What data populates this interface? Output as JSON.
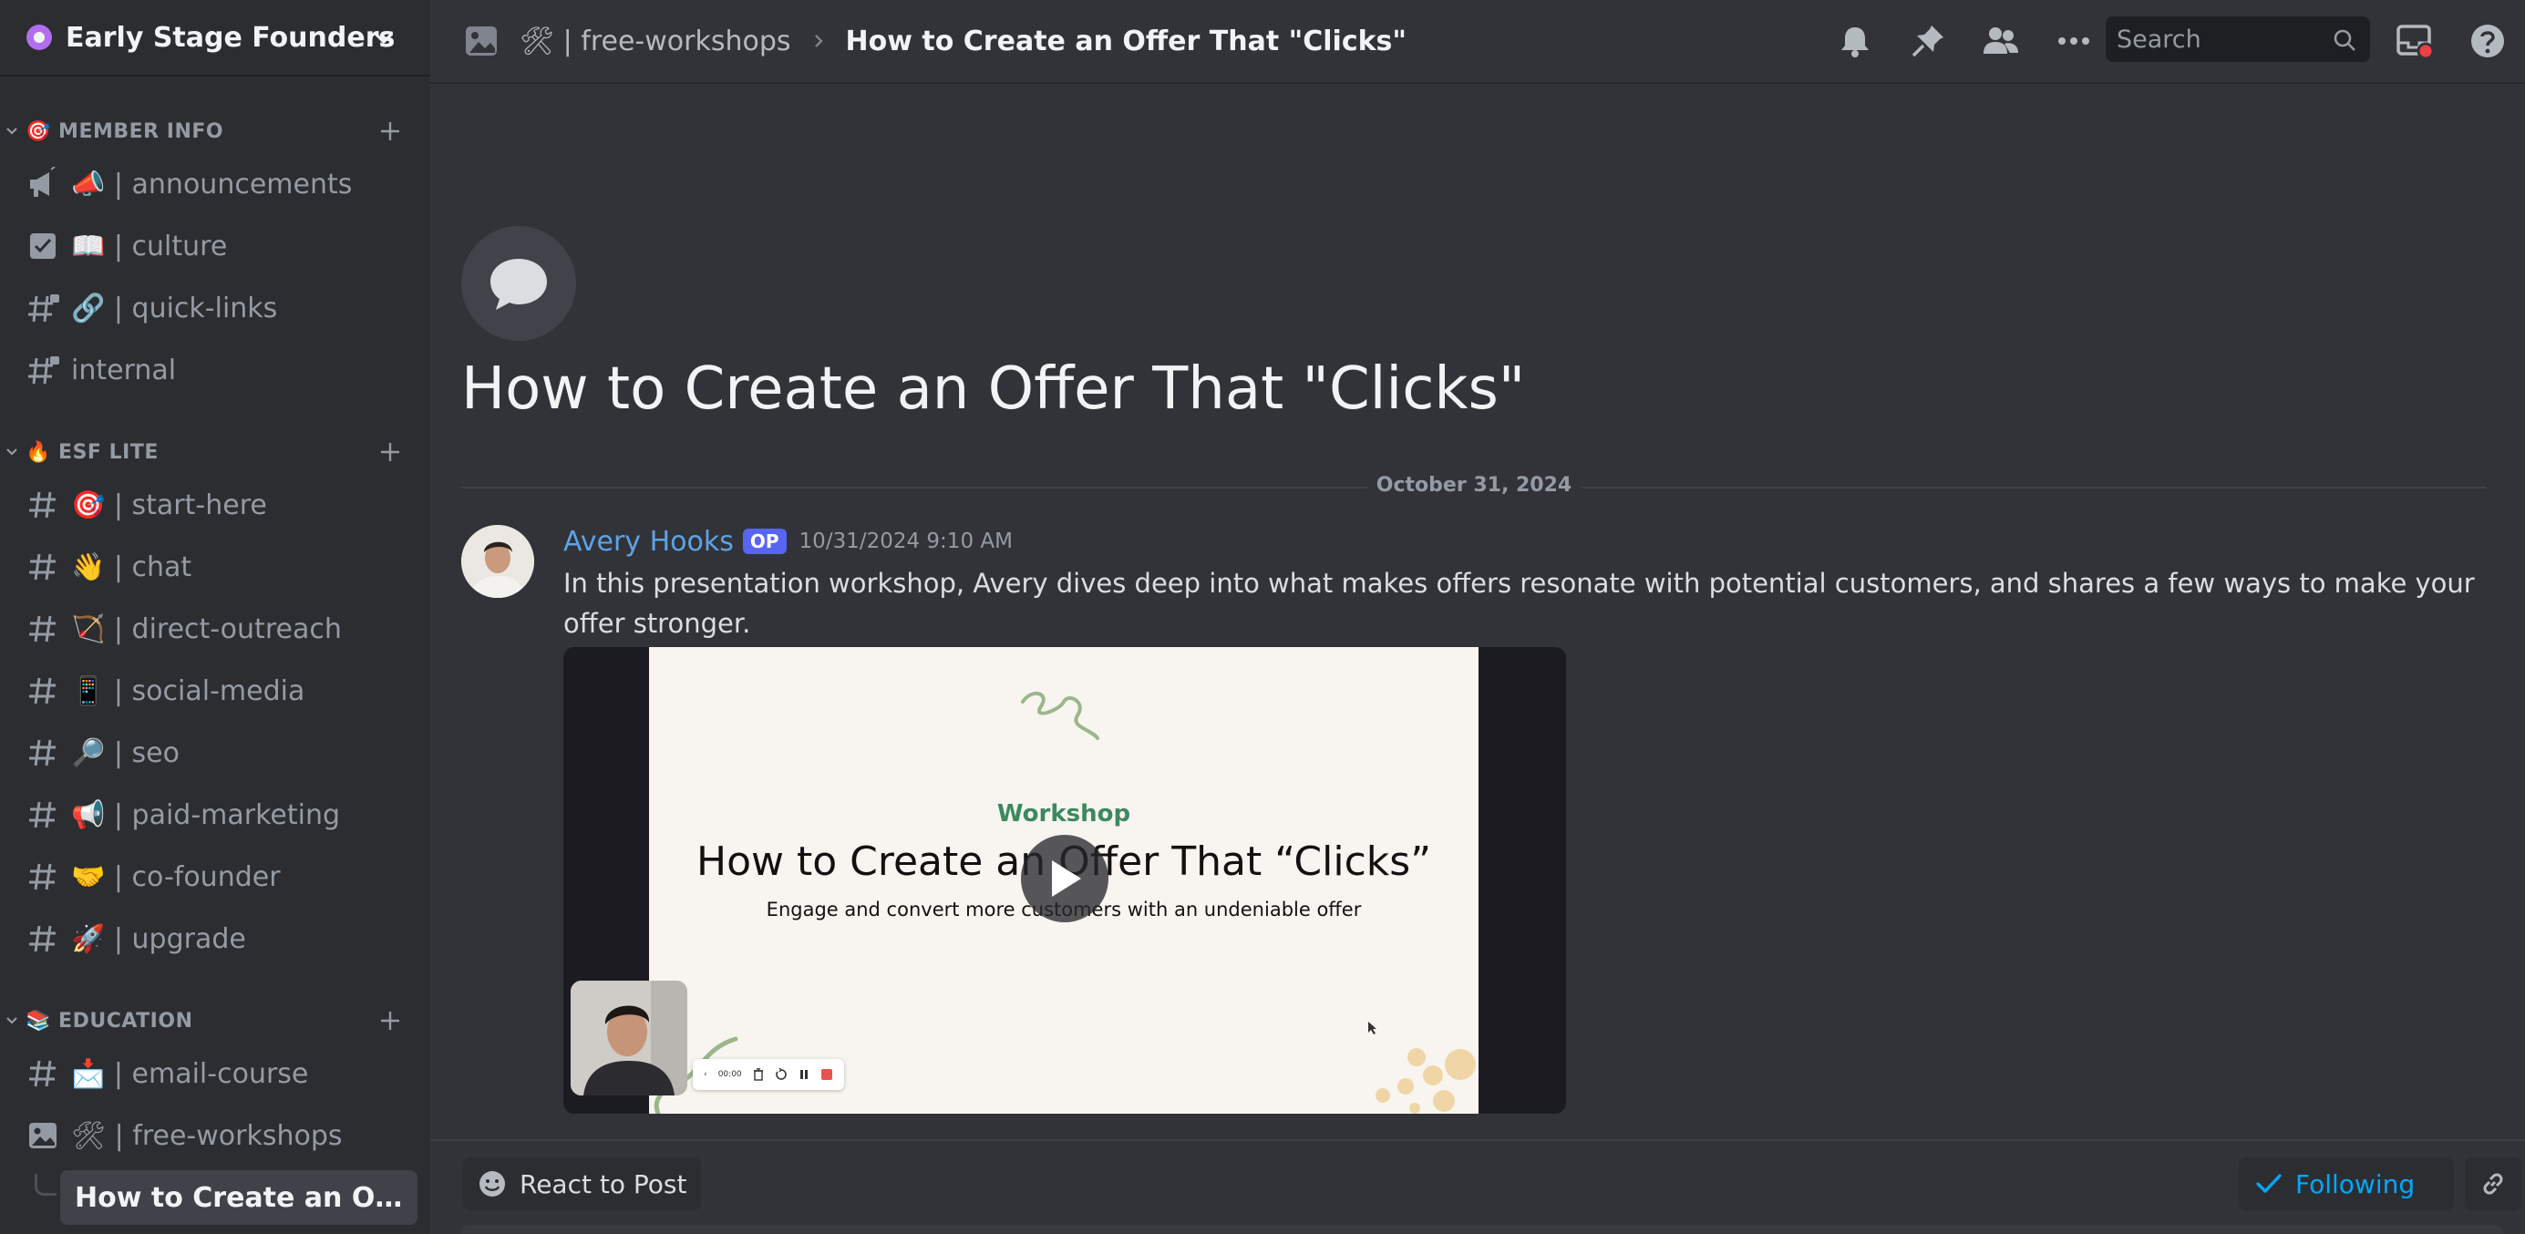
{
  "server": {
    "name": "Early Stage Founders"
  },
  "sidebar": {
    "categories": [
      {
        "label": "🎯 MEMBER INFO"
      },
      {
        "label": "🔥 ESF LITE"
      },
      {
        "label": "📚 EDUCATION"
      }
    ],
    "channels": [
      {
        "label": "📣 | announcements",
        "icon": "announcement-icon"
      },
      {
        "label": "📖 | culture",
        "icon": "rules-icon"
      },
      {
        "label": "🔗 | quick-links",
        "icon": "locked-hash-icon"
      },
      {
        "label": "internal",
        "icon": "locked-hash-icon"
      },
      {
        "label": "🎯 | start-here",
        "icon": "hash-icon"
      },
      {
        "label": "👋 | chat",
        "icon": "hash-icon"
      },
      {
        "label": "🏹 | direct-outreach",
        "icon": "hash-icon"
      },
      {
        "label": "📱 | social-media",
        "icon": "hash-icon"
      },
      {
        "label": "🔎 | seo",
        "icon": "hash-icon"
      },
      {
        "label": "📢 | paid-marketing",
        "icon": "hash-icon"
      },
      {
        "label": "🤝 | co-founder",
        "icon": "hash-icon"
      },
      {
        "label": "🚀 | upgrade",
        "icon": "hash-icon"
      },
      {
        "label": "📩 | email-course",
        "icon": "hash-icon"
      },
      {
        "label": "🛠 | free-workshops",
        "icon": "media-channel-icon"
      }
    ],
    "active_thread": {
      "label": "How to Create an Offer ..."
    }
  },
  "topbar": {
    "parent_channel": "🛠 | free-workshops",
    "current": "How to Create an Offer That \"Clicks\"",
    "search_placeholder": "Search"
  },
  "post": {
    "title": "How to Create an Offer That \"Clicks\"",
    "date_divider": "October 31, 2024",
    "author": "Avery Hooks",
    "badge": "OP",
    "timestamp": "10/31/2024 9:10 AM",
    "body": "In this presentation workshop, Avery dives deep into what makes offers resonate with potential customers, and shares a few ways to make your offer stronger.",
    "video": {
      "kicker": "Workshop",
      "title": "How to Create an Offer That “Clicks”",
      "subtitle": "Engage and convert more customers with an undeniable offer",
      "recorder_time": "00:00"
    }
  },
  "bottombar": {
    "react_label": "React to Post",
    "following_label": "Following"
  },
  "colors": {
    "accent": "#5865f2",
    "author": "#5ea3e6",
    "following": "#00a8fc",
    "slide_accent": "#3b8a5f"
  }
}
